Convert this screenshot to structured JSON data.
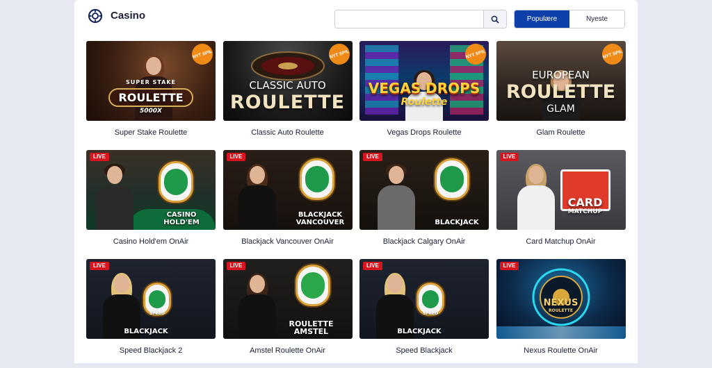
{
  "header": {
    "title": "Casino",
    "search": {
      "placeholder": "",
      "value": ""
    },
    "tabs": [
      {
        "label": "Populære",
        "active": true
      },
      {
        "label": "Nyeste",
        "active": false
      }
    ]
  },
  "games": [
    {
      "name": "Super Stake Roulette",
      "badge": "NYT SPIL",
      "thumb_text": "ROULETTE",
      "thumb_sub": "SUPER STAKE",
      "thumb_extra": "5000X"
    },
    {
      "name": "Classic Auto Roulette",
      "badge": "NYT SPIL",
      "thumb_text": "ROULETTE",
      "thumb_sub": "CLASSIC AUTO"
    },
    {
      "name": "Vegas Drops Roulette",
      "badge": "NYT SPIL",
      "thumb_text": "VEGAS DROPS",
      "thumb_sub": "Roulette"
    },
    {
      "name": "Glam Roulette",
      "badge": "NYT SPIL",
      "thumb_text": "ROULETTE",
      "thumb_sub": "EUROPEAN",
      "thumb_extra": "GLAM"
    },
    {
      "name": "Casino Hold'em OnAir",
      "badge": "LIVE",
      "thumb_text": "CASINO HOLD'EM"
    },
    {
      "name": "Blackjack Vancouver OnAir",
      "badge": "LIVE",
      "thumb_text": "BLACKJACK VANCOUVER"
    },
    {
      "name": "Blackjack Calgary OnAir",
      "badge": "LIVE",
      "thumb_text": "BLACKJACK"
    },
    {
      "name": "Card Matchup OnAir",
      "badge": "LIVE",
      "thumb_text": "CARD",
      "thumb_sub": "MATCHUP"
    },
    {
      "name": "Speed Blackjack 2",
      "badge": "LIVE",
      "thumb_text": "BLACKJACK",
      "thumb_sub": "SPEED"
    },
    {
      "name": "Amstel Roulette OnAir",
      "badge": "LIVE",
      "thumb_text": "ROULETTE AMSTEL"
    },
    {
      "name": "Speed Blackjack",
      "badge": "LIVE",
      "thumb_text": "BLACKJACK",
      "thumb_sub": "SPEED"
    },
    {
      "name": "Nexus Roulette OnAir",
      "badge": "LIVE",
      "thumb_text": "NEXUS",
      "thumb_sub": "ROULETTE"
    }
  ],
  "colors": {
    "accent": "#0f3fa8",
    "new_badge": "#f08a16",
    "live_badge": "#d8141e"
  },
  "icons": {
    "logo": "casino-chip-icon",
    "search": "search-icon"
  }
}
